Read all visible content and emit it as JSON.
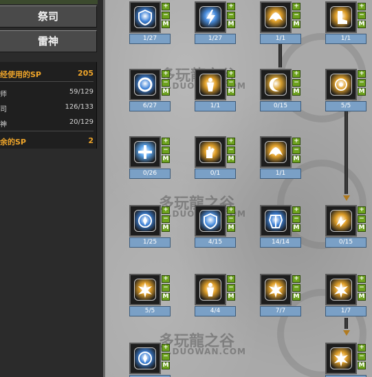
{
  "sidebar": {
    "classes": [
      {
        "label": "祭司"
      },
      {
        "label": "雷神"
      }
    ],
    "sp": {
      "used_label": "经使用的SP",
      "used_value": "205",
      "rows": [
        {
          "label": "师",
          "value": "59/129"
        },
        {
          "label": "司",
          "value": "126/133"
        },
        {
          "label": "神",
          "value": "20/129"
        }
      ],
      "remaining_label": "余的SP",
      "remaining_value": "2"
    }
  },
  "controls": {
    "plus": "+",
    "minus": "−",
    "max": "M"
  },
  "watermark": {
    "cn": "多玩龍之谷",
    "en": ".DUOWAN.COM"
  },
  "skills": [
    {
      "level": "1/27",
      "color": "#3a7fd6",
      "glyph": "shield"
    },
    {
      "level": "1/27",
      "color": "#4a8fe0",
      "glyph": "bolt"
    },
    {
      "level": "1/1",
      "color": "#e2a12a",
      "glyph": "wing"
    },
    {
      "level": "1/1",
      "color": "#e2a12a",
      "glyph": "boot"
    },
    {
      "level": "6/27",
      "color": "#3a7fd6",
      "glyph": "ring"
    },
    {
      "level": "1/1",
      "color": "#e2a12a",
      "glyph": "figure"
    },
    {
      "level": "0/15",
      "color": "#d9a12f",
      "glyph": "crescent"
    },
    {
      "level": "5/5",
      "color": "#e2a12a",
      "glyph": "halo"
    },
    {
      "level": "0/26",
      "color": "#5aa3ea",
      "glyph": "cross"
    },
    {
      "level": "0/1",
      "color": "#e2a12a",
      "glyph": "hand"
    },
    {
      "level": "1/1",
      "color": "#e2a12a",
      "glyph": "wing"
    },
    {
      "level": "1/25",
      "color": "#3a7fd6",
      "glyph": "orb"
    },
    {
      "level": "4/15",
      "color": "#4a8fe0",
      "glyph": "shield"
    },
    {
      "level": "14/14",
      "color": "#3a7fd6",
      "glyph": "armor"
    },
    {
      "level": "0/15",
      "color": "#e2a12a",
      "glyph": "spark"
    },
    {
      "level": "5/5",
      "color": "#e2a12a",
      "glyph": "burst"
    },
    {
      "level": "4/4",
      "color": "#e2a12a",
      "glyph": "figure"
    },
    {
      "level": "7/7",
      "color": "#e2a12a",
      "glyph": "burst"
    },
    {
      "level": "1/7",
      "color": "#e2a12a",
      "glyph": "burst"
    },
    {
      "level": "",
      "color": "#3a7fd6",
      "glyph": "orb"
    },
    {
      "level": "",
      "color": "#e2a12a",
      "glyph": "burst"
    }
  ]
}
